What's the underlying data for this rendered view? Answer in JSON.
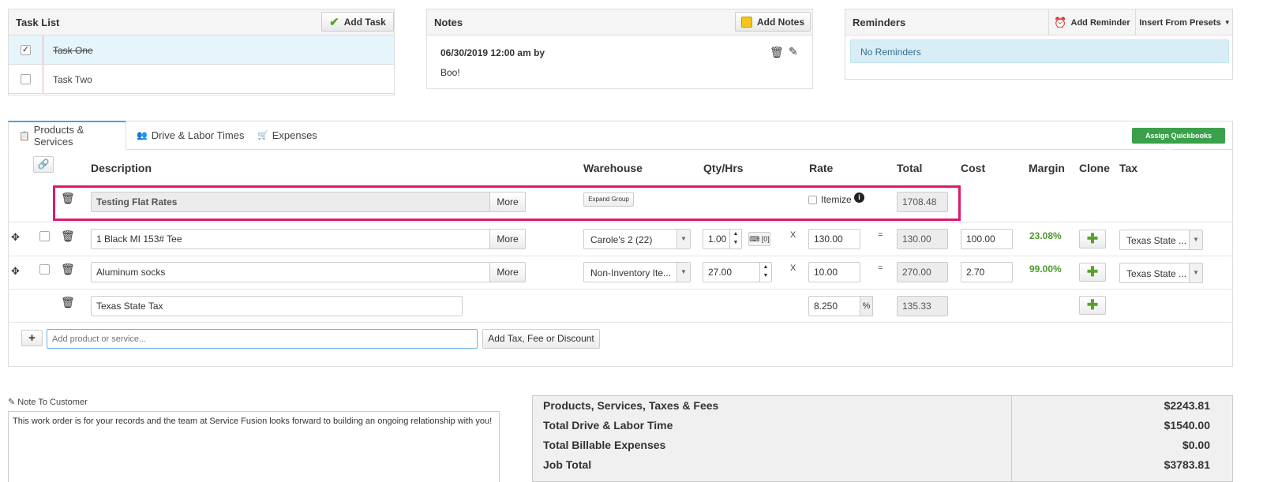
{
  "task_list": {
    "title": "Task List",
    "add_button": "Add Task",
    "tasks": [
      {
        "label": "Task One",
        "checked": true
      },
      {
        "label": "Task Two",
        "checked": false
      }
    ]
  },
  "notes": {
    "title": "Notes",
    "add_button": "Add Notes",
    "entry_header": "06/30/2019 12:00 am by",
    "entry_body": "Boo!"
  },
  "reminders": {
    "title": "Reminders",
    "add_button": "Add Reminder",
    "presets_button": "Insert From Presets",
    "empty_text": "No Reminders"
  },
  "tabs": [
    {
      "label": "Products & Services",
      "icon": "clipboard-icon"
    },
    {
      "label": "Drive & Labor Times",
      "icon": "users-icon"
    },
    {
      "label": "Expenses",
      "icon": "cart-icon"
    }
  ],
  "assign_button": "Assign Quickbooks Classes",
  "columns": {
    "description": "Description",
    "warehouse": "Warehouse",
    "qty": "Qty/Hrs",
    "rate": "Rate",
    "total": "Total",
    "cost": "Cost",
    "margin": "Margin",
    "clone": "Clone",
    "tax": "Tax"
  },
  "rows": {
    "group": {
      "description": "Testing Flat Rates",
      "more": "More",
      "expand": "Expand Group",
      "itemize": "Itemize",
      "total": "1708.48"
    },
    "item1": {
      "description": "1 Black MI 153# Tee",
      "more": "More",
      "warehouse": "Carole's 2 (22)",
      "qty": "1.00",
      "kbd_count": "[0]",
      "times": "X",
      "rate": "130.00",
      "equals": "=",
      "total": "130.00",
      "cost": "100.00",
      "margin": "23.08%",
      "tax": "Texas State ..."
    },
    "item2": {
      "description": "Aluminum socks",
      "more": "More",
      "warehouse": "Non-Inventory Ite...",
      "qty": "27.00",
      "times": "X",
      "rate": "10.00",
      "equals": "=",
      "total": "270.00",
      "cost": "2.70",
      "margin": "99.00%",
      "tax": "Texas State ..."
    },
    "tax_row": {
      "description": "Texas State Tax",
      "rate": "8.250",
      "percent": "%",
      "total": "135.33"
    }
  },
  "add_row": {
    "plus": "+",
    "placeholder": "Add product or service...",
    "tax_button": "Add Tax, Fee or Discount"
  },
  "note_to_customer": {
    "label": "Note To Customer",
    "text": "This work order is for your records and the team at Service Fusion looks forward to building an ongoing relationship with you!"
  },
  "summary": [
    {
      "label": "Products, Services, Taxes & Fees",
      "value": "$2243.81"
    },
    {
      "label": "Total Drive & Labor Time",
      "value": "$1540.00"
    },
    {
      "label": "Total Billable Expenses",
      "value": "$0.00"
    },
    {
      "label": "Job Total",
      "value": "$3783.81"
    }
  ],
  "colors": {
    "highlight": "#e0176f",
    "accent_green": "#3aa14a",
    "margin_green": "#4a9a2c",
    "tab_active": "#4aa3df",
    "reminder_bg": "#d9edf7"
  }
}
